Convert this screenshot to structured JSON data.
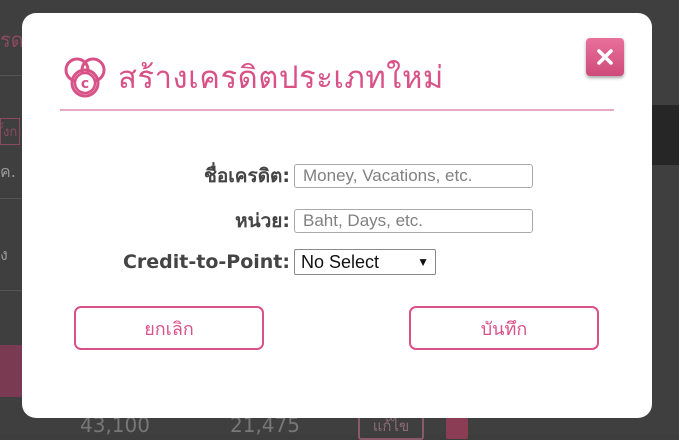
{
  "background": {
    "partial_text_1": "รด",
    "partial_text_2": "ค.",
    "partial_text_3": "ง",
    "partial_text_4": "ั้งก",
    "value_1": "43,100",
    "value_2": "21,475",
    "edit_label": "แก้ไข"
  },
  "modal": {
    "title": "สร้างเครดิตประเภทใหม่",
    "close_symbol": "✕",
    "logo_icon": "credit-c-icon",
    "fields": {
      "credit_name": {
        "label": "ชื่อเครดิต:",
        "placeholder": "Money, Vacations, etc.",
        "value": ""
      },
      "unit": {
        "label": "หน่วย:",
        "placeholder": "Baht, Days, etc.",
        "value": ""
      },
      "credit_to_point": {
        "label": "Credit-to-Point:",
        "selected": "No Select",
        "caret": "▼"
      }
    },
    "cancel_label": "ยกเลิก",
    "save_label": "บันทึก"
  },
  "colors": {
    "accent": "#d85288",
    "divider": "#e8a9c2",
    "label_text": "#444444"
  }
}
